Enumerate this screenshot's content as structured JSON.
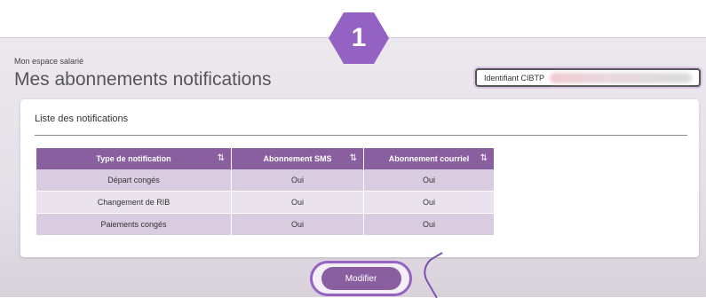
{
  "step_number": "1",
  "breadcrumb": "Mon espace salarié",
  "page_title": "Mes abonnements notifications",
  "identifier": {
    "label": "Identifiant CIBTP"
  },
  "card": {
    "title": "Liste des notifications"
  },
  "table": {
    "headers": [
      {
        "label": "Type de notification",
        "sort_icon": "⇅"
      },
      {
        "label": "Abonnement SMS",
        "sort_icon": "⇅"
      },
      {
        "label": "Abonnement courriel",
        "sort_icon": "⇅"
      }
    ],
    "rows": [
      {
        "type": "Départ congés",
        "sms": "Oui",
        "email": "Oui"
      },
      {
        "type": "Changement de RIB",
        "sms": "Oui",
        "email": "Oui"
      },
      {
        "type": "Paiements congés",
        "sms": "Oui",
        "email": "Oui"
      }
    ]
  },
  "actions": {
    "modify_label": "Modifier"
  },
  "colors": {
    "header_purple": "#8a5fa0",
    "accent_purple": "#9462c2",
    "row_odd": "#d9cce0",
    "row_even": "#eae3ee"
  }
}
